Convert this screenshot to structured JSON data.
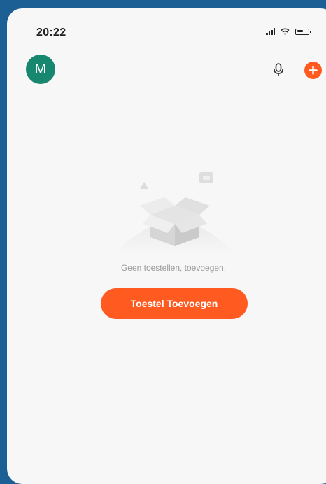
{
  "status_bar": {
    "time": "20:22"
  },
  "header": {
    "avatar_letter": "M",
    "mic_icon": "microphone-icon",
    "add_icon": "plus-icon"
  },
  "empty_state": {
    "message": "Geen toestellen, toevoegen.",
    "illustration_icon": "empty-box-icon"
  },
  "primary_action": {
    "label": "Toestel Toevoegen"
  },
  "colors": {
    "accent": "#ff5a1f",
    "avatar": "#18876f",
    "background": "#f7f7f7",
    "frame": "#1b5f95"
  }
}
